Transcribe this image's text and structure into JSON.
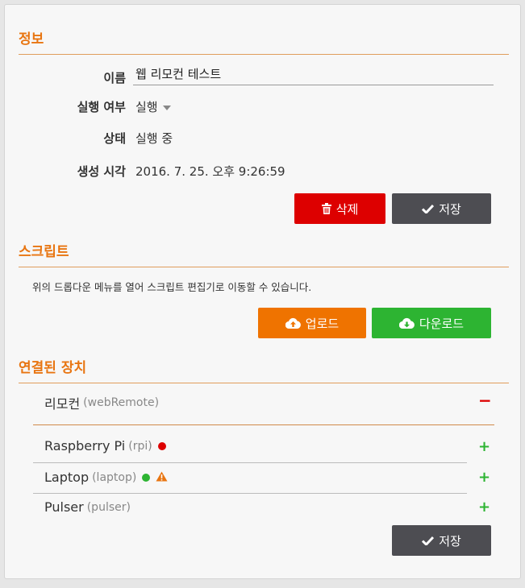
{
  "info": {
    "title": "정보",
    "name_label": "이름",
    "name_value": "웹 리모컨 테스트",
    "run_label": "실행 여부",
    "run_value": "실행",
    "state_label": "상태",
    "state_value": "실행 중",
    "created_label": "생성 시각",
    "created_value": "2016. 7. 25. 오후 9:26:59",
    "delete_label": "삭제",
    "save_label": "저장"
  },
  "script": {
    "title": "스크립트",
    "description": "위의 드롭다운 메뉴를 열어 스크립트 편집기로 이동할 수 있습니다.",
    "upload_label": "업로드",
    "download_label": "다운로드"
  },
  "devices": {
    "title": "연결된 장치",
    "connected": [
      {
        "name": "리모컨",
        "id": "(webRemote)",
        "action": "−"
      }
    ],
    "available": [
      {
        "name": "Raspberry Pi",
        "id": "(rpi)",
        "status": "offline",
        "action": "+"
      },
      {
        "name": "Laptop",
        "id": "(laptop)",
        "status": "online-warning",
        "action": "+"
      },
      {
        "name": "Pulser",
        "id": "(pulser)",
        "action": "+"
      }
    ],
    "save_label": "저장"
  },
  "colors": {
    "accent": "#e87511",
    "delete": "#dd0000",
    "save": "#4d4d52",
    "upload": "#ef7300",
    "download": "#2db432",
    "dot_offline": "#dd0000",
    "dot_online": "#2db432",
    "warning": "#e87511"
  }
}
